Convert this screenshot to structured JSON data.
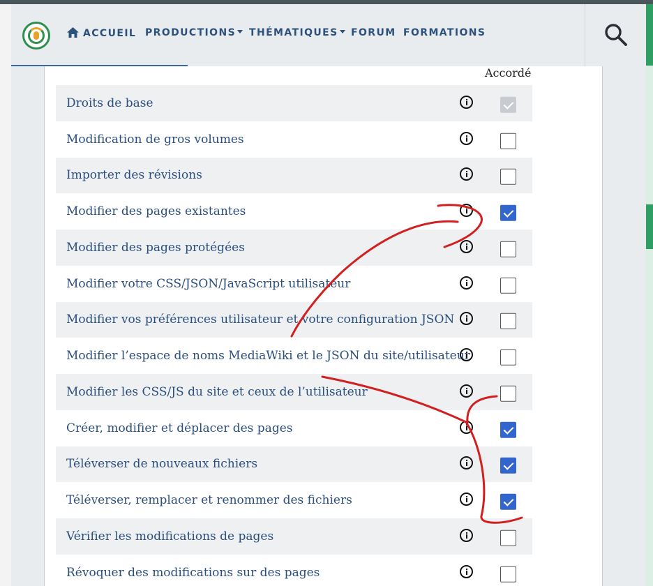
{
  "nav": {
    "home_label": "ACCUEIL",
    "items": [
      "PRODUCTIONS",
      "THÉMATIQUES",
      "FORUM",
      "FORMATIONS"
    ]
  },
  "table": {
    "column_header": "Accordé",
    "rows": [
      {
        "label": "Droits de base",
        "state": "disabled-checked"
      },
      {
        "label": "Modification de gros volumes",
        "state": "unchecked"
      },
      {
        "label": "Importer des révisions",
        "state": "unchecked"
      },
      {
        "label": "Modifier des pages existantes",
        "state": "checked"
      },
      {
        "label": "Modifier des pages protégées",
        "state": "unchecked"
      },
      {
        "label": "Modifier votre CSS/JSON/JavaScript utilisateur",
        "state": "unchecked"
      },
      {
        "label": "Modifier vos préférences utilisateur et votre configuration JSON",
        "state": "unchecked"
      },
      {
        "label": "Modifier l’espace de noms MediaWiki et le JSON du site/utilisateur",
        "state": "unchecked"
      },
      {
        "label": "Modifier les CSS/JS du site et ceux de l’utilisateur",
        "state": "unchecked"
      },
      {
        "label": "Créer, modifier et déplacer des pages",
        "state": "checked"
      },
      {
        "label": "Téléverser de nouveaux fichiers",
        "state": "checked"
      },
      {
        "label": "Téléverser, remplacer et renommer des fichiers",
        "state": "checked"
      },
      {
        "label": "Vérifier les modifications de pages",
        "state": "unchecked"
      },
      {
        "label": "Révoquer des modifications sur des pages",
        "state": "unchecked"
      }
    ]
  },
  "colors": {
    "accent": "#3366cc",
    "link": "#2a4e7d",
    "brand_green": "#2e9e62",
    "annotation": "#d21f1f"
  }
}
